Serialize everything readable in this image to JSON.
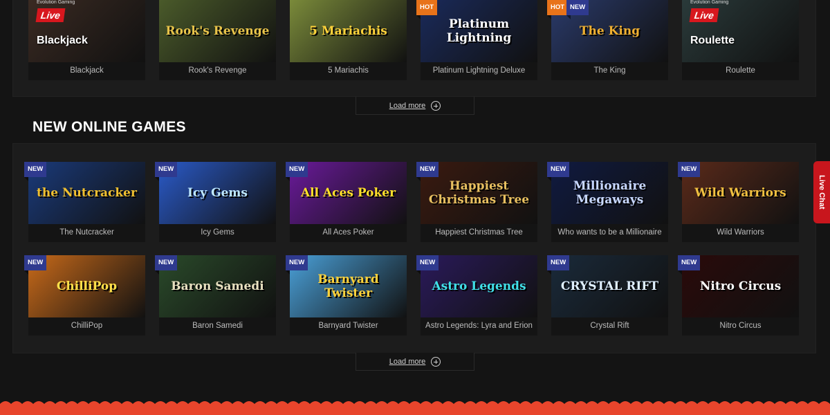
{
  "top_row": [
    {
      "name": "Blackjack",
      "bg": "#3a2a22",
      "fg": "#ffffff",
      "live": "Live",
      "provider": "Evolution Gaming",
      "caption": "Blackjack"
    },
    {
      "name": "Rook's Revenge",
      "bg": "#4a5a2a",
      "fg": "#e8c34a",
      "art": "Rook's Revenge"
    },
    {
      "name": "5 Mariachis",
      "bg": "#7a8a3a",
      "fg": "#ffd23a",
      "art": "5 Mariachis"
    },
    {
      "name": "Platinum Lightning Deluxe",
      "bg": "#1a2a5a",
      "fg": "#ffffff",
      "badge": "HOT",
      "art": "Platinum Lightning"
    },
    {
      "name": "The King",
      "bg": "#2a3a6a",
      "fg": "#f0b030",
      "badge": "HOT",
      "badge2": "NEW",
      "art": "The King"
    },
    {
      "name": "Roulette",
      "bg": "#2a3a3a",
      "fg": "#ffffff",
      "live": "Live",
      "provider": "Evolution Gaming",
      "caption": "Roulette"
    }
  ],
  "section_title": "NEW ONLINE GAMES",
  "new_row_1": [
    {
      "name": "The Nutcracker",
      "bg": "#1a3a7a",
      "fg": "#f0c030",
      "badge": "NEW",
      "art": "the Nutcracker"
    },
    {
      "name": "Icy Gems",
      "bg": "#2a5ac8",
      "fg": "#bfe9ff",
      "badge": "NEW",
      "art": "Icy Gems"
    },
    {
      "name": "All Aces Poker",
      "bg": "#6a1a9a",
      "fg": "#ffe02a",
      "badge": "NEW",
      "art": "All Aces Poker"
    },
    {
      "name": "Happiest Christmas Tree",
      "bg": "#3a1a10",
      "fg": "#e8c060",
      "badge": "NEW",
      "art": "Happiest Christmas Tree"
    },
    {
      "name": "Who wants to be a Millionaire",
      "bg": "#101a40",
      "fg": "#c8d8ff",
      "badge": "NEW",
      "art": "Millionaire Megaways"
    },
    {
      "name": "Wild Warriors",
      "bg": "#5a2a1a",
      "fg": "#f0c040",
      "badge": "NEW",
      "art": "Wild Warriors"
    }
  ],
  "new_row_2": [
    {
      "name": "ChilliPop",
      "bg": "#c86a1a",
      "fg": "#ffe04a",
      "badge": "NEW",
      "art": "ChilliPop"
    },
    {
      "name": "Baron Samedi",
      "bg": "#2a4a2a",
      "fg": "#e8e0c0",
      "badge": "NEW",
      "art": "Baron Samedi"
    },
    {
      "name": "Barnyard Twister",
      "bg": "#4aa0d8",
      "fg": "#ffd23a",
      "badge": "NEW",
      "art": "Barnyard Twister"
    },
    {
      "name": "Astro Legends: Lyra and Erion",
      "bg": "#2a1a5a",
      "fg": "#40e0e8",
      "badge": "NEW",
      "art": "Astro Legends"
    },
    {
      "name": "Crystal Rift",
      "bg": "#1a2a3a",
      "fg": "#e0f0ff",
      "badge": "NEW",
      "art": "CRYSTAL RIFT"
    },
    {
      "name": "Nitro Circus",
      "bg": "#2a0a0a",
      "fg": "#ffffff",
      "badge": "NEW",
      "art": "Nitro Circus"
    }
  ],
  "load_more_label": "Load more",
  "live_chat_label": "Live Chat",
  "footer_color": "#e8452c"
}
